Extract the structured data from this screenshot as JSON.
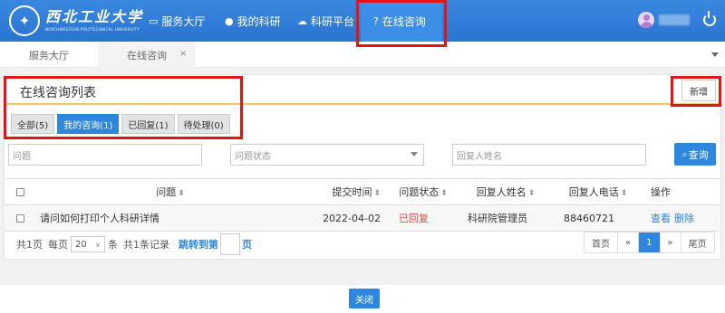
{
  "logo": {
    "cn": "西北工业大学",
    "en": "NORTHWESTERN POLYTECHNICAL UNIVERSITY"
  },
  "topnav": [
    {
      "label": "服务大厅",
      "icon": "monitor-icon"
    },
    {
      "label": "我的科研",
      "icon": "user-icon"
    },
    {
      "label": "科研平台",
      "icon": "cloud-icon"
    },
    {
      "label": "在线咨询",
      "icon": "question-circle-icon",
      "active": true
    }
  ],
  "tabs": [
    {
      "label": "服务大厅"
    },
    {
      "label": "在线咨询",
      "active": true,
      "close": "×"
    }
  ],
  "panel": {
    "title": "在线咨询列表",
    "add_label": "新增"
  },
  "filters": [
    {
      "label": "全部(5)"
    },
    {
      "label": "我的咨询(1)",
      "active": true
    },
    {
      "label": "已回复(1)"
    },
    {
      "label": "待处理(0)"
    }
  ],
  "search": {
    "question_placeholder": "问题",
    "status_placeholder": "问题状态",
    "replier_placeholder": "回复人姓名",
    "query_label": "查询"
  },
  "table": {
    "columns": [
      "问题",
      "提交时间",
      "问题状态",
      "回复人姓名",
      "回复人电话",
      "操作"
    ],
    "rows": [
      {
        "question": "请问如何打印个人科研详情",
        "time": "2022-04-02",
        "status": "已回复",
        "replier": "科研院管理员",
        "phone": "88460721",
        "view": "查看",
        "delete": "删除"
      }
    ]
  },
  "pagination": {
    "total_pages": "共1页",
    "per_page_prefix": "每页",
    "per_page": "20",
    "per_page_suffix": "条",
    "total_records": "共1条记录",
    "jump_prefix": "跳转到第",
    "jump_suffix": "页",
    "first": "首页",
    "prev": "«",
    "current": "1",
    "next": "»",
    "last": "尾页"
  },
  "footer": {
    "close_label": "关闭"
  },
  "colors": {
    "nav_bg": "#2f7ed8",
    "accent": "#2e86de",
    "status_replied": "#e04a3a",
    "highlight": "#e21414",
    "divider": "#f0c66a"
  }
}
